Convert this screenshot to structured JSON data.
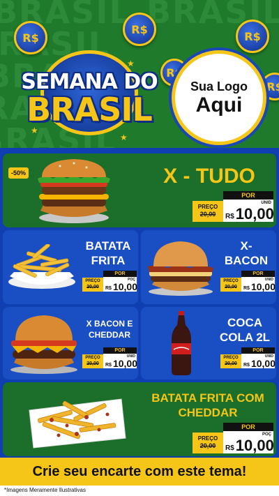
{
  "header": {
    "bg_word": "BRASIL",
    "coin_symbol": "R$",
    "title_line1": "SEMANA DO",
    "title_line2": "BRASIL",
    "logo_line1": "Sua Logo",
    "logo_line2": "Aqui"
  },
  "products": [
    {
      "name_lines": [
        "X - TUDO"
      ],
      "discount": "-50%",
      "price_label": "PREÇO",
      "old_price": "20,00",
      "new_label": "POR",
      "currency": "R$",
      "new_price": "10,00",
      "unit": "UNID"
    },
    {
      "name_lines": [
        "BATATA",
        "FRITA"
      ],
      "price_label": "PREÇO",
      "old_price": "20,00",
      "new_label": "POR",
      "currency": "R$",
      "new_price": "10,00",
      "unit": "POÇ"
    },
    {
      "name_lines": [
        "X-",
        "BACON"
      ],
      "price_label": "PREÇO",
      "old_price": "20,00",
      "new_label": "POR",
      "currency": "R$",
      "new_price": "10,00",
      "unit": "UNID"
    },
    {
      "name_lines": [
        "X BACON E",
        "CHEDDAR"
      ],
      "price_label": "PREÇO",
      "old_price": "20,00",
      "new_label": "POR",
      "currency": "R$",
      "new_price": "10,00",
      "unit": "UNID"
    },
    {
      "name_lines": [
        "COCA",
        "COLA 2L"
      ],
      "price_label": "PREÇO",
      "old_price": "20,00",
      "new_label": "POR",
      "currency": "R$",
      "new_price": "10,00",
      "unit": "UNID"
    },
    {
      "name_lines": [
        "BATATA FRITA COM",
        "CHEDDAR"
      ],
      "price_label": "PREÇO",
      "old_price": "20,00",
      "new_label": "POR",
      "currency": "R$",
      "new_price": "10,00",
      "unit": "POÇ"
    }
  ],
  "cta": {
    "text": "Crie seu encarte com este tema!"
  },
  "footnote": "*Imagens Meramente Ilustrativas",
  "colors": {
    "green": "#1b6f2a",
    "blue": "#0f3fb0",
    "card_blue": "#1a4fc4",
    "yellow": "#f5c518"
  }
}
